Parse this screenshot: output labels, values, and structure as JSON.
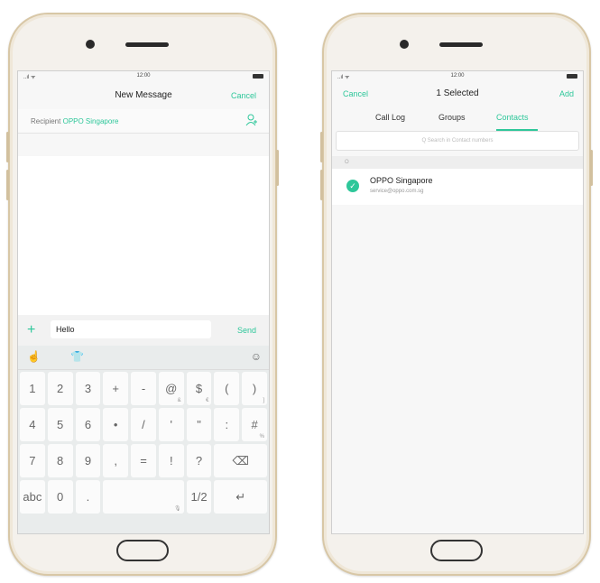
{
  "left_phone": {
    "status": {
      "signal": "..ıl ᯤ",
      "time": "12:00"
    },
    "nav": {
      "title": "New Message",
      "cancel": "Cancel"
    },
    "recipient": {
      "label": "Recipient",
      "name": "OPPO Singapore"
    },
    "compose": {
      "text": "Hello",
      "send": "Send",
      "plus": "+"
    },
    "keyboard": {
      "toolbar_icons": [
        "hand-icon",
        "shirt-icon",
        "emoji-icon"
      ],
      "rows": [
        [
          {
            "main": "1",
            "sub": ""
          },
          {
            "main": "2",
            "sub": ""
          },
          {
            "main": "3",
            "sub": ""
          },
          {
            "main": "+",
            "sub": ""
          },
          {
            "main": "-",
            "sub": ""
          },
          {
            "main": "@",
            "sub": "&"
          },
          {
            "main": "$",
            "sub": "€"
          },
          {
            "main": "(",
            "sub": ""
          },
          {
            "main": ")",
            "sub": "]"
          }
        ],
        [
          {
            "main": "4",
            "sub": ""
          },
          {
            "main": "5",
            "sub": ""
          },
          {
            "main": "6",
            "sub": ""
          },
          {
            "main": "•",
            "sub": ""
          },
          {
            "main": "/",
            "sub": ""
          },
          {
            "main": "'",
            "sub": ""
          },
          {
            "main": "\"",
            "sub": ""
          },
          {
            "main": ":",
            "sub": ""
          },
          {
            "main": "#",
            "sub": "%"
          }
        ],
        [
          {
            "main": "7",
            "sub": ""
          },
          {
            "main": "8",
            "sub": ""
          },
          {
            "main": "9",
            "sub": ""
          },
          {
            "main": ",",
            "sub": ""
          },
          {
            "main": "=",
            "sub": ""
          },
          {
            "main": "!",
            "sub": ""
          },
          {
            "main": "?",
            "sub": ""
          },
          {
            "main": "⌫",
            "sub": ""
          }
        ],
        [
          {
            "main": "abc",
            "sub": ""
          },
          {
            "main": "0",
            "sub": ""
          },
          {
            "main": ".",
            "sub": ""
          },
          {
            "main": "",
            "sub": "🎙"
          },
          {
            "main": "1/2",
            "sub": ""
          },
          {
            "main": "↵",
            "sub": ""
          }
        ]
      ]
    }
  },
  "right_phone": {
    "status": {
      "signal": "..ıl ᯤ",
      "time": "12:00"
    },
    "nav": {
      "cancel": "Cancel",
      "title": "1 Selected",
      "add": "Add"
    },
    "tabs": [
      "Call Log",
      "Groups",
      "Contacts"
    ],
    "active_tab": "Contacts",
    "search_placeholder": "Q  Search in Contact numbers",
    "section_letter": "O",
    "contact": {
      "name": "OPPO Singapore",
      "email": "service@oppo.com.sg",
      "selected": true
    }
  },
  "colors": {
    "accent": "#2ec79a",
    "frame": "#d8c7a6",
    "body": "#f4f1ec"
  }
}
